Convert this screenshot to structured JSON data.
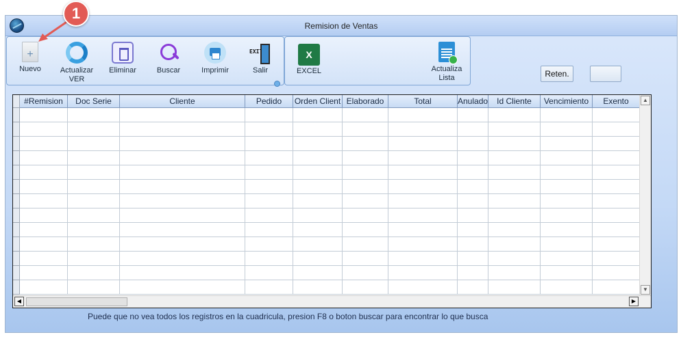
{
  "window": {
    "title": "Remision de Ventas"
  },
  "toolbar": {
    "nuevo": "Nuevo",
    "actualizar": "Actualizar\nVER",
    "eliminar": "Eliminar",
    "buscar": "Buscar",
    "imprimir": "Imprimir",
    "salir": "Salir",
    "excel": "EXCEL",
    "actualiza_lista": "Actualiza\nLista",
    "reten": "Reten.",
    "blank": "",
    "exit_icon_text": "EXIT"
  },
  "grid": {
    "columns": [
      "#Remision",
      "Doc Serie",
      "Cliente",
      "Pedido",
      "Orden Client",
      "Elaborado",
      "Total",
      "Anulado",
      "Id Cliente",
      "Vencimiento",
      "Exento"
    ],
    "rows": []
  },
  "status": {
    "hint": "Puede que no vea todos los registros en la cuadricula, presion F8 o boton buscar para encontrar lo que busca"
  },
  "annotation": {
    "badge": "1",
    "color": "#e25b55"
  },
  "colors": {
    "accent": "#7fa6d6",
    "window_bg": "#c4d9f6"
  }
}
